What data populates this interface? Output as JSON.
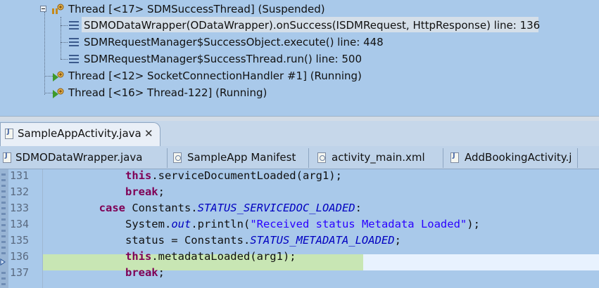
{
  "debug_view": {
    "threads": [
      {
        "label": "Thread [<17> SDMSuccessThread] (Suspended)"
      },
      {
        "label": "Thread [<12> SocketConnectionHandler #1] (Running)"
      },
      {
        "label": "Thread [<16> Thread-122] (Running)"
      }
    ],
    "frames": [
      {
        "label": "SDMODataWrapper(ODataWrapper).onSuccess(ISDMRequest, HttpResponse) line: 136"
      },
      {
        "label": "SDMRequestManager$SuccessObject.execute() line: 448"
      },
      {
        "label": "SDMRequestManager$SuccessThread.run() line: 500"
      }
    ]
  },
  "editor_tabs": {
    "active": {
      "label": "SampleAppActivity.java",
      "close": "✕"
    },
    "others": [
      {
        "label": "SDMODataWrapper.java"
      },
      {
        "label": "SampleApp Manifest"
      },
      {
        "label": "activity_main.xml"
      },
      {
        "label": "AddBookingActivity.j"
      }
    ]
  },
  "code": {
    "lines": [
      {
        "no": "131",
        "indent": "            ",
        "parts": [
          {
            "t": "this",
            "c": "kw"
          },
          {
            "t": ".serviceDocumentLoaded(arg1);",
            "c": ""
          }
        ]
      },
      {
        "no": "132",
        "indent": "            ",
        "parts": [
          {
            "t": "break",
            "c": "kw"
          },
          {
            "t": ";",
            "c": ""
          }
        ]
      },
      {
        "no": "133",
        "indent": "        ",
        "parts": [
          {
            "t": "case",
            "c": "kw"
          },
          {
            "t": " Constants.",
            "c": ""
          },
          {
            "t": "STATUS_SERVICEDOC_LOADED",
            "c": "const"
          },
          {
            "t": ":",
            "c": ""
          }
        ]
      },
      {
        "no": "134",
        "indent": "            ",
        "parts": [
          {
            "t": "System.",
            "c": ""
          },
          {
            "t": "out",
            "c": "ital"
          },
          {
            "t": ".println(",
            "c": ""
          },
          {
            "t": "\"Received status Metadata Loaded\"",
            "c": "str"
          },
          {
            "t": ");",
            "c": ""
          }
        ]
      },
      {
        "no": "135",
        "indent": "            ",
        "parts": [
          {
            "t": "status = Constants.",
            "c": ""
          },
          {
            "t": "STATUS_METADATA_LOADED",
            "c": "const"
          },
          {
            "t": ";",
            "c": ""
          }
        ]
      },
      {
        "no": "136",
        "indent": "            ",
        "parts": [
          {
            "t": "this",
            "c": "kw"
          },
          {
            "t": ".metadataLoaded(arg1);",
            "c": ""
          }
        ]
      },
      {
        "no": "137",
        "indent": "            ",
        "parts": [
          {
            "t": "break",
            "c": "kw"
          },
          {
            "t": ";",
            "c": ""
          }
        ]
      }
    ],
    "current_line": "136"
  },
  "colors": {
    "background": "#a9c9ea",
    "keyword": "#7f0055",
    "string": "#2a00ff",
    "constant": "#0000c0",
    "current_line": "#c8e6b4"
  },
  "icons": {
    "thread_suspended": "thread-suspended-icon",
    "thread_running": "thread-running-icon",
    "stack_frame": "stack-frame-icon",
    "java_file": "java-file-icon",
    "manifest_file": "manifest-file-icon",
    "xml_file": "xml-file-icon",
    "instruction_pointer": "instruction-pointer-icon"
  }
}
